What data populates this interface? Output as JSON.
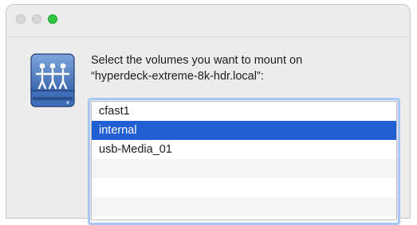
{
  "window": {
    "controls": {
      "close_icon": "close-dot",
      "minimize_icon": "minimize-dot",
      "zoom_icon": "zoom-dot",
      "zoom_color": "#2ac940",
      "inactive_color": "#d6d6d6"
    }
  },
  "dialog": {
    "icon": "network-drive-icon",
    "prompt_line1": "Select the volumes you want to mount on",
    "prompt_line2": "“hyperdeck-extreme-8k-hdr.local”:"
  },
  "volumes": [
    {
      "label": "cfast1",
      "selected": false
    },
    {
      "label": "internal",
      "selected": true
    },
    {
      "label": "usb-Media_01",
      "selected": false
    },
    {
      "label": "",
      "selected": false
    },
    {
      "label": "",
      "selected": false
    },
    {
      "label": "",
      "selected": false
    }
  ],
  "colors": {
    "selection": "#1f5fd1",
    "focus_ring": "#a6c7f5",
    "window_bg": "#ececec"
  }
}
